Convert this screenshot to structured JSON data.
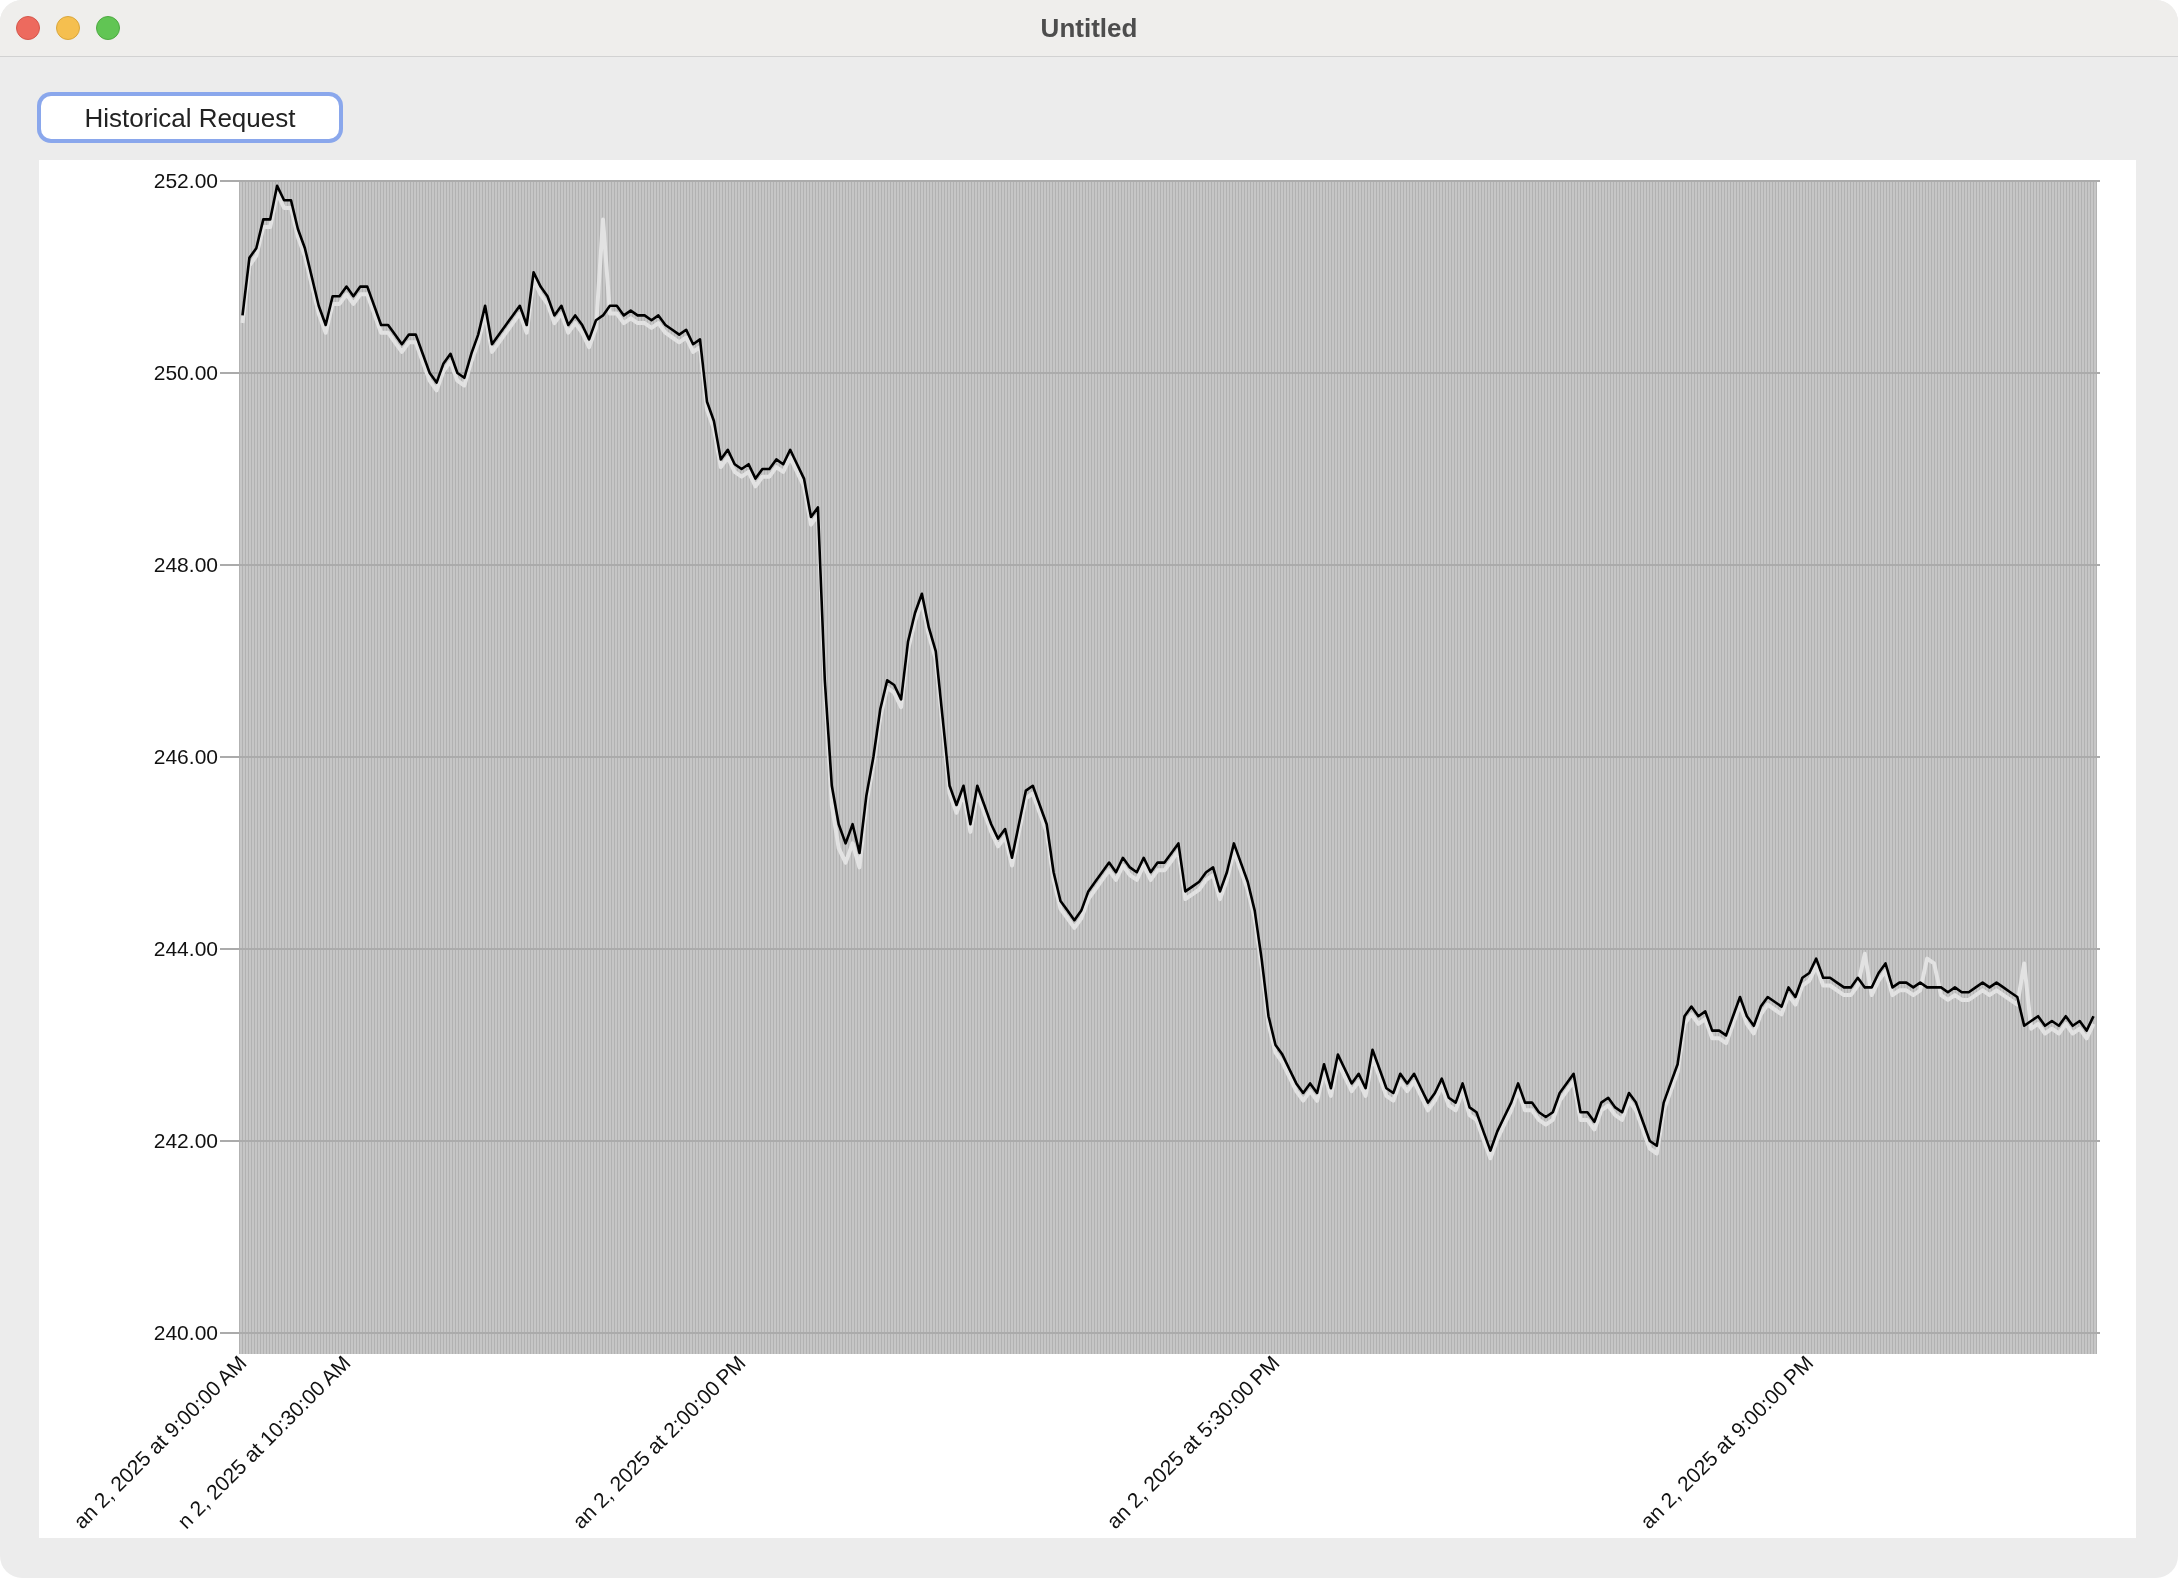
{
  "window": {
    "title": "Untitled"
  },
  "toolbar": {
    "buttons": [
      {
        "label": "Historical Request",
        "focused": true
      }
    ]
  },
  "chart": {
    "chart_data": {
      "type": "line",
      "grid": true,
      "ylim": [
        240,
        252
      ],
      "yticks": [
        {
          "value": 240,
          "label": "240.00"
        },
        {
          "value": 242,
          "label": "242.00"
        },
        {
          "value": 244,
          "label": "244.00"
        },
        {
          "value": 246,
          "label": "246.00"
        },
        {
          "value": 248,
          "label": "248.00"
        },
        {
          "value": 250,
          "label": "250.00"
        },
        {
          "value": 252,
          "label": "252.00"
        }
      ],
      "categories": [
        "an 2, 2025 at 9:00:00 AM",
        null,
        null,
        null,
        null,
        null,
        null,
        null,
        null,
        null,
        null,
        null,
        null,
        null,
        null,
        "n 2, 2025 at 10:30:00 AM",
        null,
        null,
        null,
        null,
        null,
        null,
        null,
        null,
        null,
        null,
        null,
        null,
        null,
        null,
        null,
        null,
        null,
        null,
        null,
        null,
        null,
        null,
        null,
        null,
        null,
        null,
        null,
        null,
        null,
        null,
        null,
        null,
        null,
        null,
        null,
        null,
        null,
        null,
        null,
        null,
        null,
        null,
        null,
        null,
        null,
        null,
        null,
        null,
        null,
        null,
        null,
        null,
        null,
        null,
        null,
        null,
        "an 2, 2025 at 2:00:00 PM",
        null,
        null,
        null,
        null,
        null,
        null,
        null,
        null,
        null,
        null,
        null,
        null,
        null,
        null,
        null,
        null,
        null,
        null,
        null,
        null,
        null,
        null,
        null,
        null,
        null,
        null,
        null,
        null,
        null,
        null,
        null,
        null,
        null,
        null,
        null,
        null,
        null,
        null,
        null,
        null,
        null,
        null,
        null,
        null,
        null,
        null,
        null,
        null,
        null,
        null,
        null,
        null,
        null,
        null,
        null,
        null,
        null,
        null,
        null,
        null,
        null,
        null,
        null,
        null,
        null,
        null,
        null,
        null,
        null,
        null,
        null,
        null,
        null,
        null,
        null,
        null,
        "an 2, 2025 at 5:30:00 PM",
        null,
        null,
        null,
        null,
        null,
        null,
        null,
        null,
        null,
        null,
        null,
        null,
        null,
        null,
        null,
        null,
        null,
        null,
        null,
        null,
        null,
        null,
        null,
        null,
        null,
        null,
        null,
        null,
        null,
        null,
        null,
        null,
        null,
        null,
        null,
        null,
        null,
        null,
        null,
        null,
        null,
        null,
        null,
        null,
        null,
        null,
        null,
        null,
        null,
        null,
        null,
        null,
        null,
        null,
        null,
        null,
        null,
        null,
        null,
        null,
        null,
        null,
        null,
        null,
        null,
        null,
        null,
        null,
        null,
        null,
        null,
        null,
        null,
        null,
        null,
        null,
        "an 2, 2025 at 9:00:00 PM",
        null,
        null,
        null,
        null,
        null,
        null,
        null,
        null,
        null,
        null,
        null,
        null,
        null,
        null,
        null,
        null,
        null,
        null,
        null,
        null,
        null,
        null,
        null,
        null,
        null,
        null,
        null,
        null,
        null,
        null,
        null,
        null,
        null,
        null,
        null,
        null,
        null,
        null,
        null,
        null,
        null
      ],
      "series": [
        {
          "color": "#e2e2e2",
          "values": [
            250.52,
            251.12,
            251.22,
            251.52,
            251.52,
            251.87,
            251.72,
            251.72,
            251.42,
            251.22,
            250.92,
            250.62,
            250.42,
            250.72,
            250.72,
            250.82,
            250.72,
            250.82,
            250.82,
            250.62,
            250.42,
            250.42,
            250.32,
            250.22,
            250.32,
            250.32,
            250.12,
            249.92,
            249.82,
            250.02,
            250.12,
            249.92,
            249.87,
            250.12,
            250.32,
            250.62,
            250.22,
            250.32,
            250.42,
            250.52,
            250.62,
            250.42,
            250.97,
            250.82,
            250.72,
            250.52,
            250.62,
            250.42,
            250.52,
            250.42,
            250.27,
            250.47,
            251.6,
            250.62,
            250.62,
            250.52,
            250.57,
            250.52,
            250.52,
            250.47,
            250.52,
            250.42,
            250.37,
            250.32,
            250.37,
            250.22,
            250.27,
            249.62,
            249.42,
            249.02,
            249.12,
            248.97,
            248.92,
            248.97,
            248.82,
            248.92,
            248.92,
            249.02,
            248.97,
            249.12,
            248.97,
            248.82,
            248.42,
            248.52,
            246.72,
            245.5,
            245.05,
            244.9,
            245.1,
            244.85,
            245.52,
            245.92,
            246.42,
            246.72,
            246.67,
            246.52,
            247.12,
            247.42,
            247.62,
            247.27,
            247.02,
            246.32,
            245.62,
            245.42,
            245.62,
            245.22,
            245.62,
            245.42,
            245.22,
            245.07,
            245.17,
            244.87,
            245.22,
            245.57,
            245.62,
            245.42,
            245.22,
            244.72,
            244.42,
            244.32,
            244.22,
            244.32,
            244.52,
            244.62,
            244.72,
            244.82,
            244.72,
            244.87,
            244.77,
            244.72,
            244.87,
            244.72,
            244.82,
            244.82,
            244.92,
            245.02,
            244.52,
            244.57,
            244.62,
            244.72,
            244.77,
            244.52,
            244.72,
            245.02,
            244.82,
            244.62,
            244.32,
            243.82,
            243.22,
            242.92,
            242.82,
            242.67,
            242.52,
            242.42,
            242.52,
            242.42,
            242.72,
            242.47,
            242.82,
            242.67,
            242.52,
            242.62,
            242.47,
            242.87,
            242.67,
            242.47,
            242.42,
            242.62,
            242.52,
            242.62,
            242.47,
            242.32,
            242.42,
            242.57,
            242.37,
            242.32,
            242.52,
            242.27,
            242.22,
            242.02,
            241.82,
            242.02,
            242.17,
            242.32,
            242.52,
            242.32,
            242.32,
            242.22,
            242.17,
            242.22,
            242.42,
            242.52,
            242.62,
            242.22,
            242.22,
            242.12,
            242.32,
            242.37,
            242.27,
            242.22,
            242.42,
            242.32,
            242.12,
            241.92,
            241.87,
            242.32,
            242.52,
            242.72,
            243.22,
            243.32,
            243.22,
            243.27,
            243.07,
            243.07,
            243.02,
            243.22,
            243.42,
            243.22,
            243.12,
            243.32,
            243.42,
            243.37,
            243.32,
            243.52,
            243.42,
            243.62,
            243.67,
            243.82,
            243.62,
            243.62,
            243.57,
            243.52,
            243.52,
            243.62,
            243.95,
            243.52,
            243.67,
            243.77,
            243.52,
            243.57,
            243.57,
            243.52,
            243.57,
            243.9,
            243.85,
            243.52,
            243.47,
            243.52,
            243.47,
            243.47,
            243.52,
            243.57,
            243.52,
            243.57,
            243.52,
            243.47,
            243.42,
            243.85,
            243.17,
            243.22,
            243.12,
            243.17,
            243.12,
            243.22,
            243.12,
            243.17,
            243.07,
            243.22
          ]
        },
        {
          "color": "#000000",
          "values": [
            250.6,
            251.2,
            251.3,
            251.6,
            251.6,
            251.95,
            251.8,
            251.8,
            251.5,
            251.3,
            251.0,
            250.7,
            250.5,
            250.8,
            250.8,
            250.9,
            250.8,
            250.9,
            250.9,
            250.7,
            250.5,
            250.5,
            250.4,
            250.3,
            250.4,
            250.4,
            250.2,
            250.0,
            249.9,
            250.1,
            250.2,
            250.0,
            249.95,
            250.2,
            250.4,
            250.7,
            250.3,
            250.4,
            250.5,
            250.6,
            250.7,
            250.5,
            251.05,
            250.9,
            250.8,
            250.6,
            250.7,
            250.5,
            250.6,
            250.5,
            250.35,
            250.55,
            250.6,
            250.7,
            250.7,
            250.6,
            250.65,
            250.6,
            250.6,
            250.55,
            250.6,
            250.5,
            250.45,
            250.4,
            250.45,
            250.3,
            250.35,
            249.7,
            249.5,
            249.1,
            249.2,
            249.05,
            249.0,
            249.05,
            248.9,
            249.0,
            249.0,
            249.1,
            249.05,
            249.2,
            249.05,
            248.9,
            248.5,
            248.6,
            246.8,
            245.7,
            245.3,
            245.1,
            245.3,
            245.0,
            245.6,
            246.0,
            246.5,
            246.8,
            246.75,
            246.6,
            247.2,
            247.5,
            247.7,
            247.35,
            247.1,
            246.4,
            245.7,
            245.5,
            245.7,
            245.3,
            245.7,
            245.5,
            245.3,
            245.15,
            245.25,
            244.95,
            245.3,
            245.65,
            245.7,
            245.5,
            245.3,
            244.8,
            244.5,
            244.4,
            244.3,
            244.4,
            244.6,
            244.7,
            244.8,
            244.9,
            244.8,
            244.95,
            244.85,
            244.8,
            244.95,
            244.8,
            244.9,
            244.9,
            245.0,
            245.1,
            244.6,
            244.65,
            244.7,
            244.8,
            244.85,
            244.6,
            244.8,
            245.1,
            244.9,
            244.7,
            244.4,
            243.9,
            243.3,
            243.0,
            242.9,
            242.75,
            242.6,
            242.5,
            242.6,
            242.5,
            242.8,
            242.55,
            242.9,
            242.75,
            242.6,
            242.7,
            242.55,
            242.95,
            242.75,
            242.55,
            242.5,
            242.7,
            242.6,
            242.7,
            242.55,
            242.4,
            242.5,
            242.65,
            242.45,
            242.4,
            242.6,
            242.35,
            242.3,
            242.1,
            241.9,
            242.1,
            242.25,
            242.4,
            242.6,
            242.4,
            242.4,
            242.3,
            242.25,
            242.3,
            242.5,
            242.6,
            242.7,
            242.3,
            242.3,
            242.2,
            242.4,
            242.45,
            242.35,
            242.3,
            242.5,
            242.4,
            242.2,
            242.0,
            241.95,
            242.4,
            242.6,
            242.8,
            243.3,
            243.4,
            243.3,
            243.35,
            243.15,
            243.15,
            243.1,
            243.3,
            243.5,
            243.3,
            243.2,
            243.4,
            243.5,
            243.45,
            243.4,
            243.6,
            243.5,
            243.7,
            243.75,
            243.9,
            243.7,
            243.7,
            243.65,
            243.6,
            243.6,
            243.7,
            243.6,
            243.6,
            243.75,
            243.85,
            243.6,
            243.65,
            243.65,
            243.6,
            243.65,
            243.6,
            243.6,
            243.6,
            243.55,
            243.6,
            243.55,
            243.55,
            243.6,
            243.65,
            243.6,
            243.65,
            243.6,
            243.55,
            243.5,
            243.2,
            243.25,
            243.3,
            243.2,
            243.25,
            243.2,
            243.3,
            243.2,
            243.25,
            243.15,
            243.3
          ]
        }
      ]
    }
  }
}
